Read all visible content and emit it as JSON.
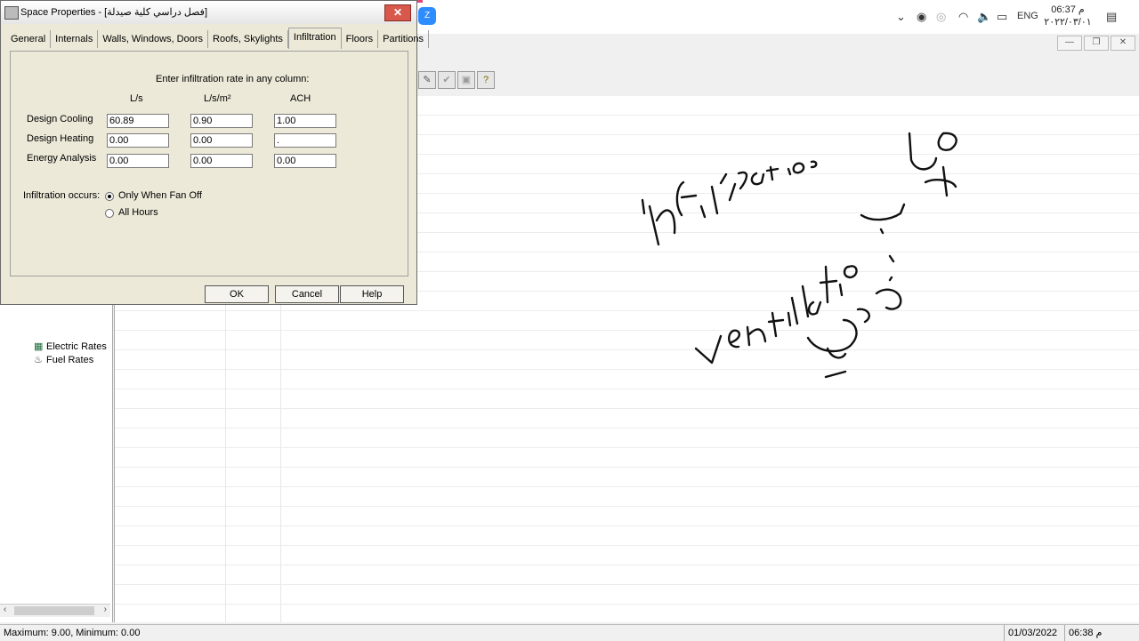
{
  "taskbar": {
    "clock_time": "06:37 م",
    "clock_date": "٢٠٢٢/٠٣/٠١",
    "lang": "ENG",
    "zoom_label": "Z"
  },
  "dialog": {
    "title": "Space Properties - [فصل دراسي كلية صيدلة]",
    "close_label": "✕",
    "tabs": [
      "General",
      "Internals",
      "Walls, Windows, Doors",
      "Roofs, Skylights",
      "Infiltration",
      "Floors",
      "Partitions"
    ],
    "active_tab": "Infiltration",
    "instruction": "Enter infiltration rate in any column:",
    "columns": [
      "L/s",
      "L/s/m²",
      "ACH"
    ],
    "rows": [
      {
        "label": "Design Cooling",
        "values": [
          "60.89",
          "0.90",
          "1.00"
        ]
      },
      {
        "label": "Design Heating",
        "values": [
          "0.00",
          "0.00",
          "."
        ]
      },
      {
        "label": "Energy Analysis",
        "values": [
          "0.00",
          "0.00",
          "0.00"
        ]
      }
    ],
    "infiltration_label": "Infiltration occurs:",
    "options": [
      {
        "label": "Only When Fan Off",
        "selected": true
      },
      {
        "label": "All Hours",
        "selected": false
      }
    ],
    "buttons": {
      "ok": "OK",
      "cancel": "Cancel",
      "help": "Help"
    }
  },
  "tree": {
    "items": [
      "Electric Rates",
      "Fuel Rates"
    ]
  },
  "statusbar": {
    "left": "Maximum: 9.00, Minimum: 0.00",
    "date": "01/03/2022",
    "time": "06:38 م"
  },
  "handwriting": {
    "word1": "infiltration",
    "word2": "ventilation",
    "arabic1": "معدل التسرب",
    "arabic2": "التهوية"
  },
  "colors": {
    "dialog_bg": "#ece9d8",
    "close_button": "#d8584b",
    "zoom_icon": "#2d8cff"
  }
}
